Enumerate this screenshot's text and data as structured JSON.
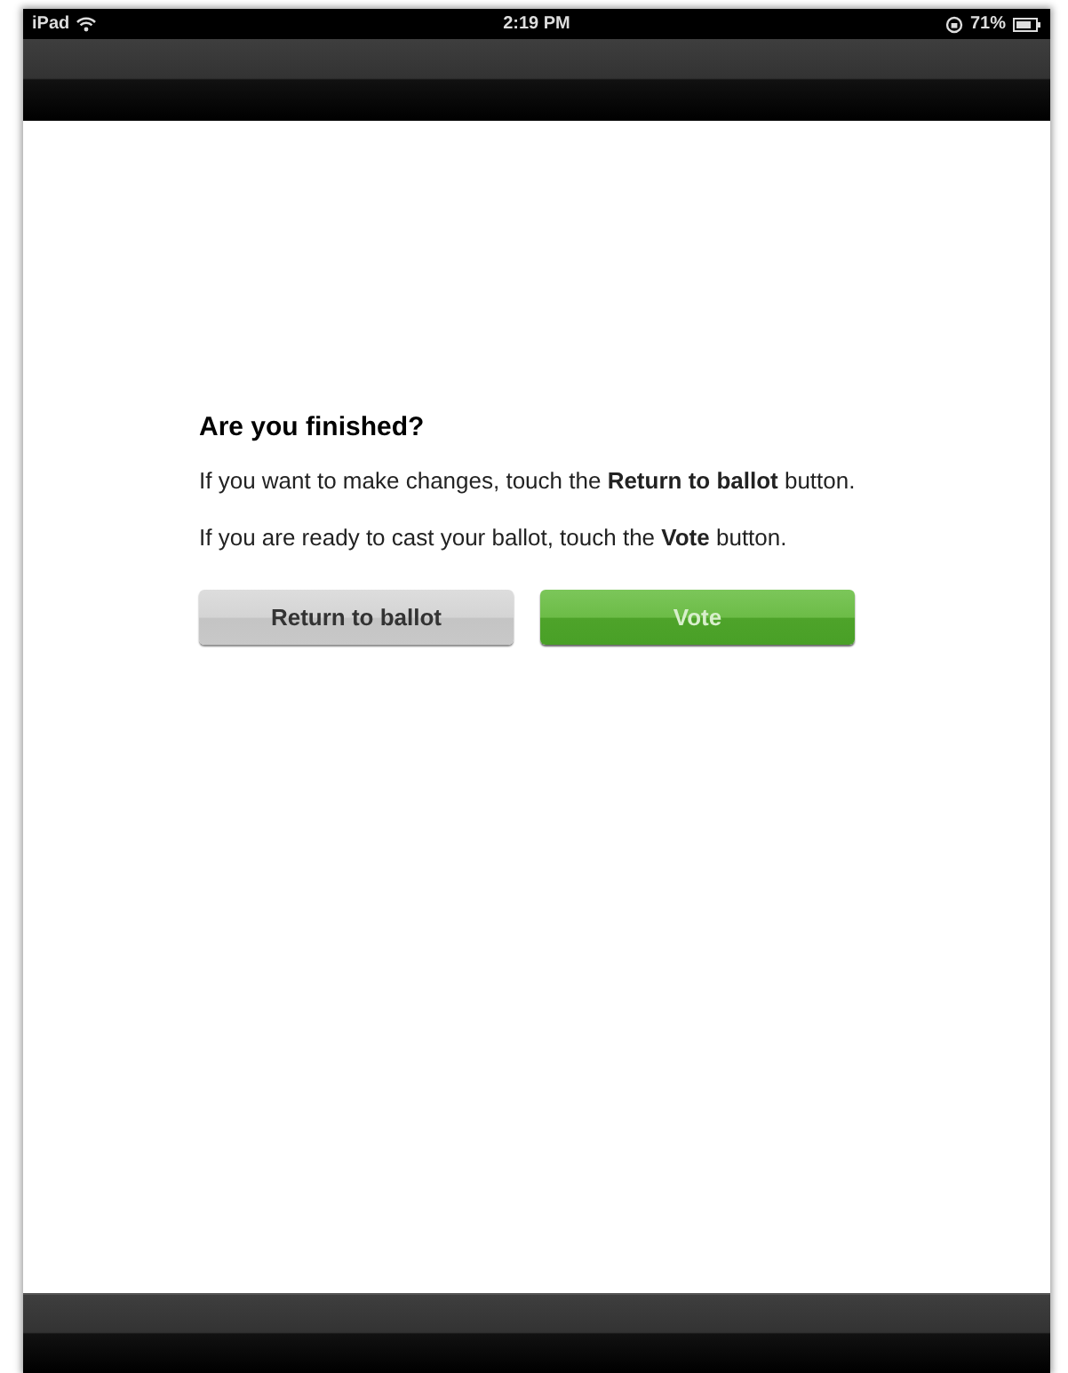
{
  "status_bar": {
    "device": "iPad",
    "time": "2:19 PM",
    "battery": "71%"
  },
  "dialog": {
    "title": "Are you finished?",
    "paragraphs": [
      "If you want to make changes, touch the **Return to ballot** button.",
      "If you are ready to cast your ballot, touch the **Vote** button."
    ],
    "buttons": [
      {
        "label": "Return to ballot",
        "kind": "secondary"
      },
      {
        "label": "Vote",
        "kind": "primary"
      }
    ]
  }
}
